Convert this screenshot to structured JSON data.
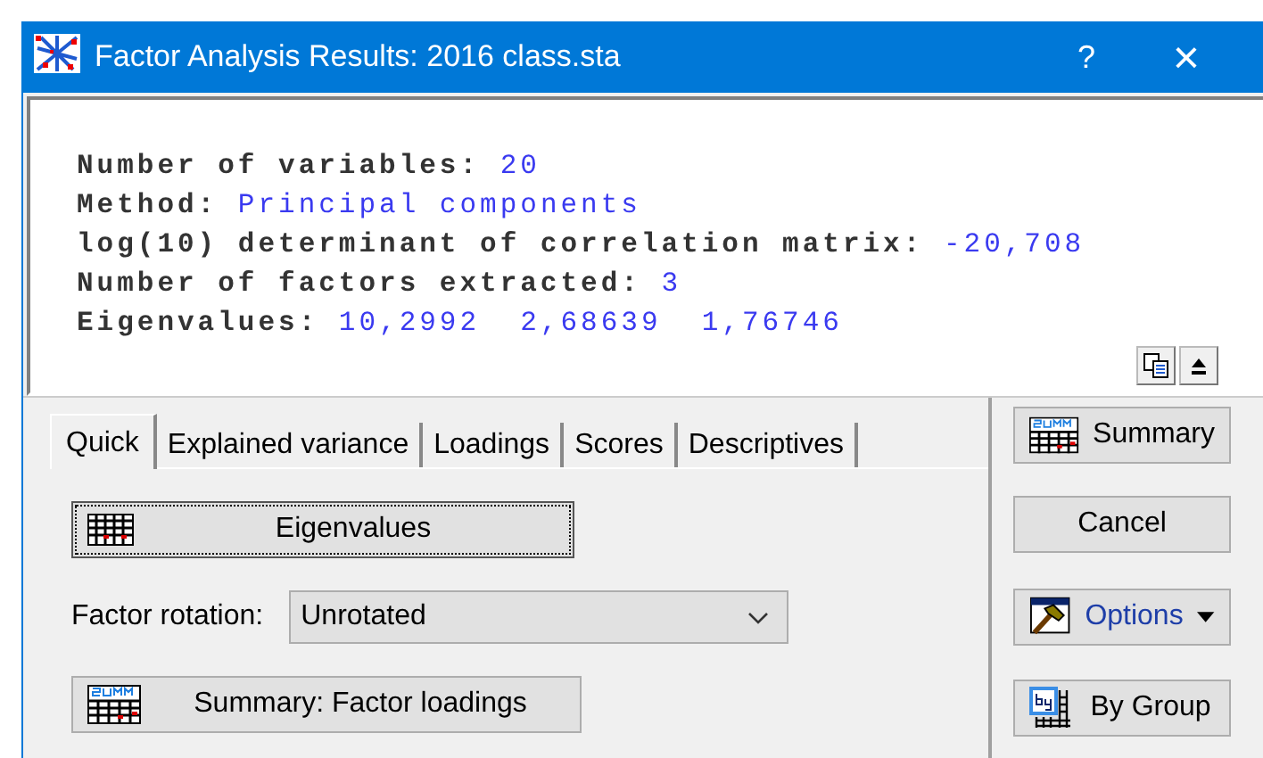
{
  "window": {
    "title": "Factor Analysis Results: 2016 class.sta",
    "help": "?",
    "close": "×"
  },
  "output": {
    "lines": [
      {
        "label": "Number of variables:",
        "value": "20"
      },
      {
        "label": "Method:",
        "value": "Principal components"
      },
      {
        "label": "log(10) determinant of correlation matrix:",
        "value": "-20,708"
      },
      {
        "label": "Number of factors extracted:",
        "value": "3"
      },
      {
        "label": "Eigenvalues:",
        "value": "10,2992  2,68639  1,76746"
      }
    ]
  },
  "tabs": [
    {
      "label": "Quick",
      "selected": true
    },
    {
      "label": "Explained variance",
      "selected": false
    },
    {
      "label": "Loadings",
      "selected": false
    },
    {
      "label": "Scores",
      "selected": false
    },
    {
      "label": "Descriptives",
      "selected": false
    }
  ],
  "quick": {
    "eigenvalues_button": {
      "label": "Eigenvalues",
      "focused": true
    },
    "factor_rotation": {
      "label": "Factor rotation:",
      "value": "Unrotated"
    },
    "summary_button": {
      "label": "Summary: Factor loadings",
      "focused": false
    }
  },
  "side_buttons": [
    {
      "label": "Summary",
      "kind": "summary"
    },
    {
      "label": "Cancel",
      "kind": "plain"
    },
    {
      "label": "Options",
      "kind": "options"
    },
    {
      "label": "By Group",
      "kind": "group"
    }
  ]
}
